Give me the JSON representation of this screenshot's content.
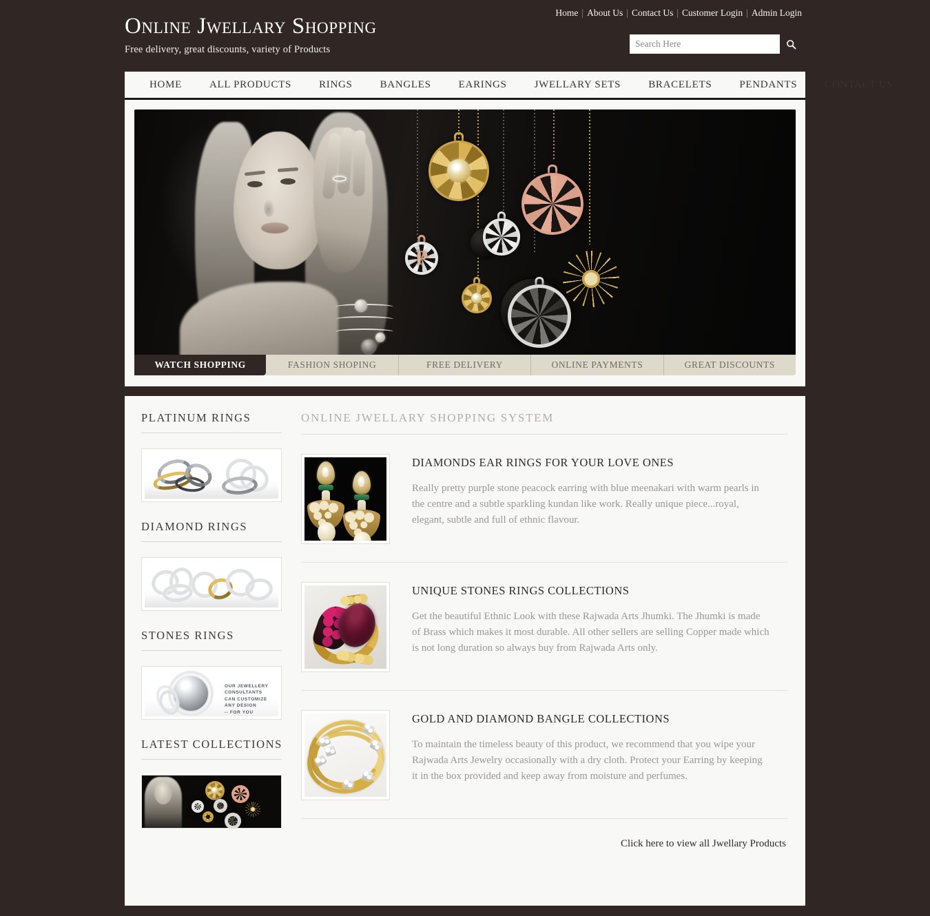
{
  "site": {
    "title": "Online Jwellary Shopping",
    "tagline": "Free delivery, great discounts, variety of Products"
  },
  "top_links": [
    {
      "label": "Home"
    },
    {
      "label": "About Us"
    },
    {
      "label": "Contact Us"
    },
    {
      "label": "Customer Login"
    },
    {
      "label": "Admin Login"
    }
  ],
  "search": {
    "placeholder": "Search Here",
    "value": "",
    "icon": "search-icon"
  },
  "main_nav": [
    {
      "label": "HOME"
    },
    {
      "label": "ALL PRODUCTS"
    },
    {
      "label": "RINGS"
    },
    {
      "label": "BANGLES"
    },
    {
      "label": "EARINGS"
    },
    {
      "label": "JWELLARY SETS"
    },
    {
      "label": "BRACELETS"
    },
    {
      "label": "PENDANTS"
    },
    {
      "label": "CONTACT US"
    }
  ],
  "banner": {
    "description": "Black and white portrait of a blonde woman wearing rings and charm bracelets, beside hanging circular gold, rose gold and silver filigree pendants",
    "tabs": [
      {
        "label": "WATCH SHOPPING",
        "active": true
      },
      {
        "label": "FASHION SHOPING",
        "active": false
      },
      {
        "label": "FREE DELIVERY",
        "active": false
      },
      {
        "label": "ONLINE PAYMENTS",
        "active": false
      },
      {
        "label": "GREAT DISCOUNTS",
        "active": false
      }
    ]
  },
  "sidebar": {
    "sections": [
      {
        "heading": "PLATINUM RINGS",
        "image_alt": "platinum-and-gold-wedding-bands"
      },
      {
        "heading": "DIAMOND RINGS",
        "image_alt": "cluster-of-diamond-rings"
      },
      {
        "heading": "STONES RINGS",
        "image_alt": "grey-pearl-ring-with-diamond-halo",
        "image_text": "OUR JEWELLERY\nCONSULTANTS\nCAN CUSTOMIZE\nANY DESIGN\n-- FOR YOU"
      },
      {
        "heading": "LATEST COLLECTIONS",
        "image_alt": "model-with-hanging-pendant-collection"
      }
    ]
  },
  "main": {
    "heading": "ONLINE JWELLARY SHOPPING SYSTEM",
    "articles": [
      {
        "title": "DIAMONDS EAR RINGS FOR YOUR LOVE ONES",
        "text": "Really pretty purple stone peacock earring with blue meenakari with warm pearls in the centre and a subtle sparkling kundan like work. Really unique piece...royal, elegant, subtle and full of ethnic flavour.",
        "image_alt": "kundan-chandelier-earrings-on-black"
      },
      {
        "title": "UNIQUE STONES RINGS COLLECTIONS",
        "text": "Get the beautiful Ethnic Look with these Rajwada Arts Jhumki. The Jhumki is made of Brass which makes it most durable. All other sellers are selling Copper made which is not long duration so always buy from Rajwada Arts only.",
        "image_alt": "gold-ring-with-ruby-cabochon-and-pink-stones"
      },
      {
        "title": "GOLD AND DIAMOND BANGLE COLLECTIONS",
        "text": "To maintain the timeless beauty of this product, we recommend that you wipe your Rajwada Arts Jewelry occasionally with a dry cloth. Protect your Earring by keeping it in the box provided and keep away from moisture and perfumes.",
        "image_alt": "gold-bangles-with-diamond-stations"
      }
    ],
    "more_link": "Click here to view all Jwellary Products"
  },
  "colors": {
    "page_background": "#302724",
    "shell_background": "#f8f8f7",
    "nav_text": "#3a3330",
    "tab_inactive_bg": "#dedacb",
    "tab_active_bg": "#302724",
    "body_text": "#9b9894",
    "heading_text": "#2f2b28",
    "page_heading_text": "#b2aeaa"
  }
}
